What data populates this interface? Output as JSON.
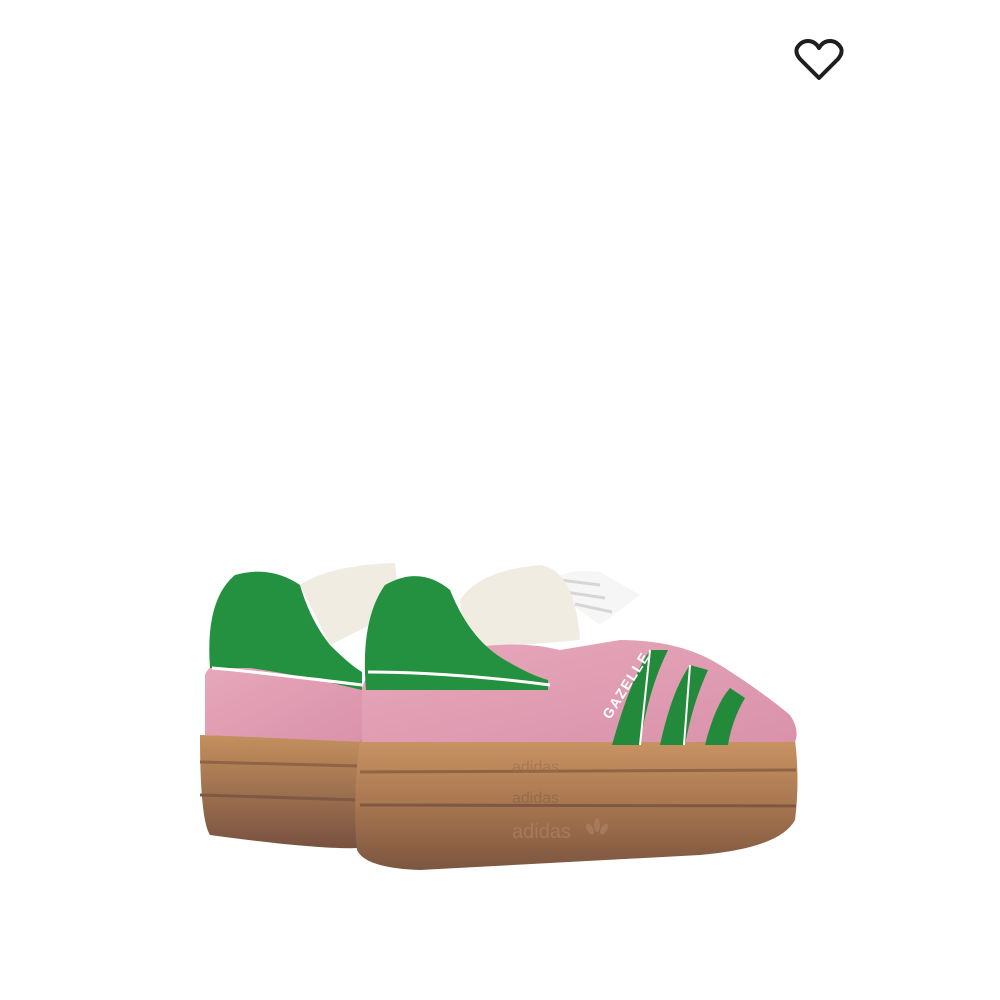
{
  "product": {
    "sole_branding": [
      "adidas",
      "adidas",
      "adidas"
    ],
    "side_label": "GAZELLE",
    "colors": {
      "upper": "#df9eb1",
      "stripes": "#238a3b",
      "sole": "#b07d4f",
      "heart": "#1e1e1e"
    }
  },
  "wishlist": {
    "icon": "heart-outline-icon"
  }
}
